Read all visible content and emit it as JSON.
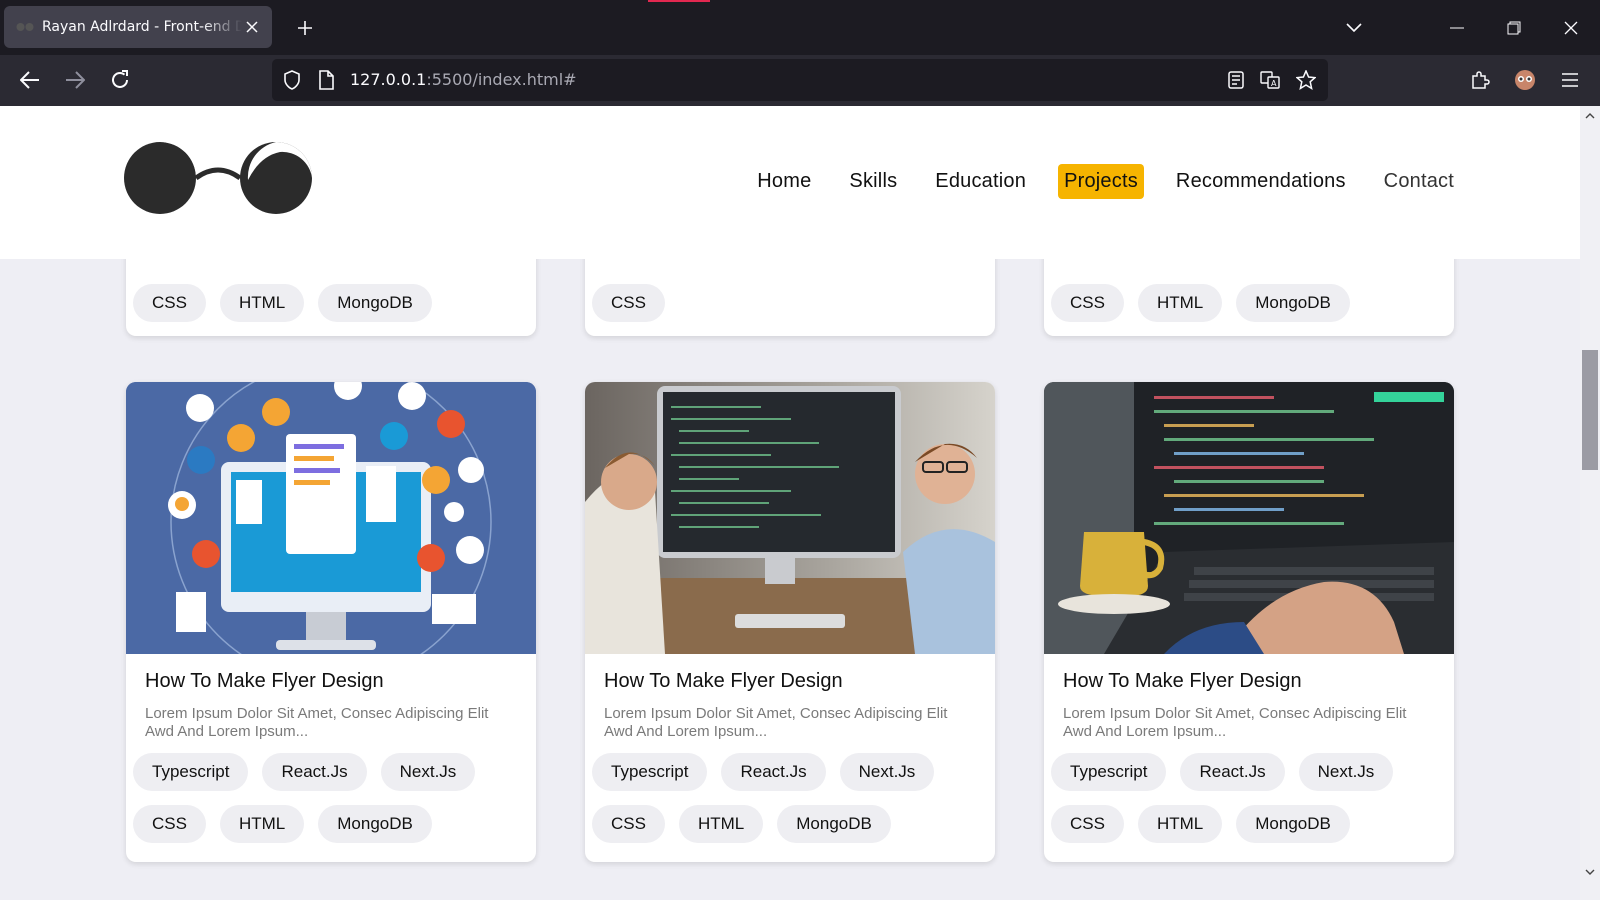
{
  "browser": {
    "tab_title": "Rayan Adlrdard - Front-end Developer",
    "url_host": "127.0.0.1",
    "url_path": ":5500/index.html#"
  },
  "site": {
    "nav": [
      {
        "label": "Home"
      },
      {
        "label": "Skills"
      },
      {
        "label": "Education"
      },
      {
        "label": "Projects",
        "active": true
      },
      {
        "label": "Recommendations"
      },
      {
        "label": "Contact"
      }
    ],
    "accent_color": "#f6b400"
  },
  "top_cards": [
    {
      "tags": [
        "CSS",
        "HTML",
        "MongoDB"
      ]
    },
    {
      "tags": [
        "CSS"
      ]
    },
    {
      "tags": [
        "CSS",
        "HTML",
        "MongoDB"
      ]
    }
  ],
  "cards": [
    {
      "image": "illustration-computer-apps",
      "title": "How To Make Flyer Design",
      "description": "Lorem Ipsum Dolor Sit Amet, Consec Adipiscing Elit Awd And Lorem Ipsum...",
      "tags": [
        "Typescript",
        "React.Js",
        "Next.Js",
        "CSS",
        "HTML",
        "MongoDB"
      ]
    },
    {
      "image": "photo-two-developers-at-desktop",
      "title": "How To Make Flyer Design",
      "description": "Lorem Ipsum Dolor Sit Amet, Consec Adipiscing Elit Awd And Lorem Ipsum...",
      "tags": [
        "Typescript",
        "React.Js",
        "Next.Js",
        "CSS",
        "HTML",
        "MongoDB"
      ]
    },
    {
      "image": "photo-laptop-coding-with-coffee",
      "title": "How To Make Flyer Design",
      "description": "Lorem Ipsum Dolor Sit Amet, Consec Adipiscing Elit Awd And Lorem Ipsum...",
      "tags": [
        "Typescript",
        "React.Js",
        "Next.Js",
        "CSS",
        "HTML",
        "MongoDB"
      ]
    }
  ]
}
